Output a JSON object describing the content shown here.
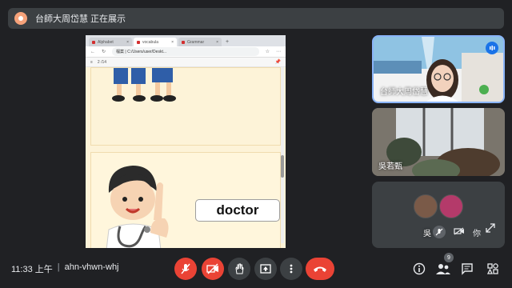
{
  "presenter": {
    "text": "台師大周岱慧 正在展示"
  },
  "browser": {
    "tabs": [
      {
        "label": "Alphabet"
      },
      {
        "label": "vocabula"
      },
      {
        "label": "Grammar"
      }
    ],
    "address": "檔案 | C:/Users/user/Deskt...",
    "page_info": "2  /14"
  },
  "shared_content": {
    "word_card": "doctor"
  },
  "participants": [
    {
      "name": "台師大周岱慧"
    },
    {
      "name": "吳若甄"
    },
    {
      "name_initial": "吳",
      "you_label": "你"
    }
  ],
  "meeting": {
    "time": "11:33 上午",
    "separator": "|",
    "code": "ahn-vhwn-whj"
  },
  "participant_count": "9",
  "colors": {
    "background": "#202124",
    "control": "#3c4043",
    "danger": "#ea4335",
    "active_border": "#8ab4f8"
  }
}
